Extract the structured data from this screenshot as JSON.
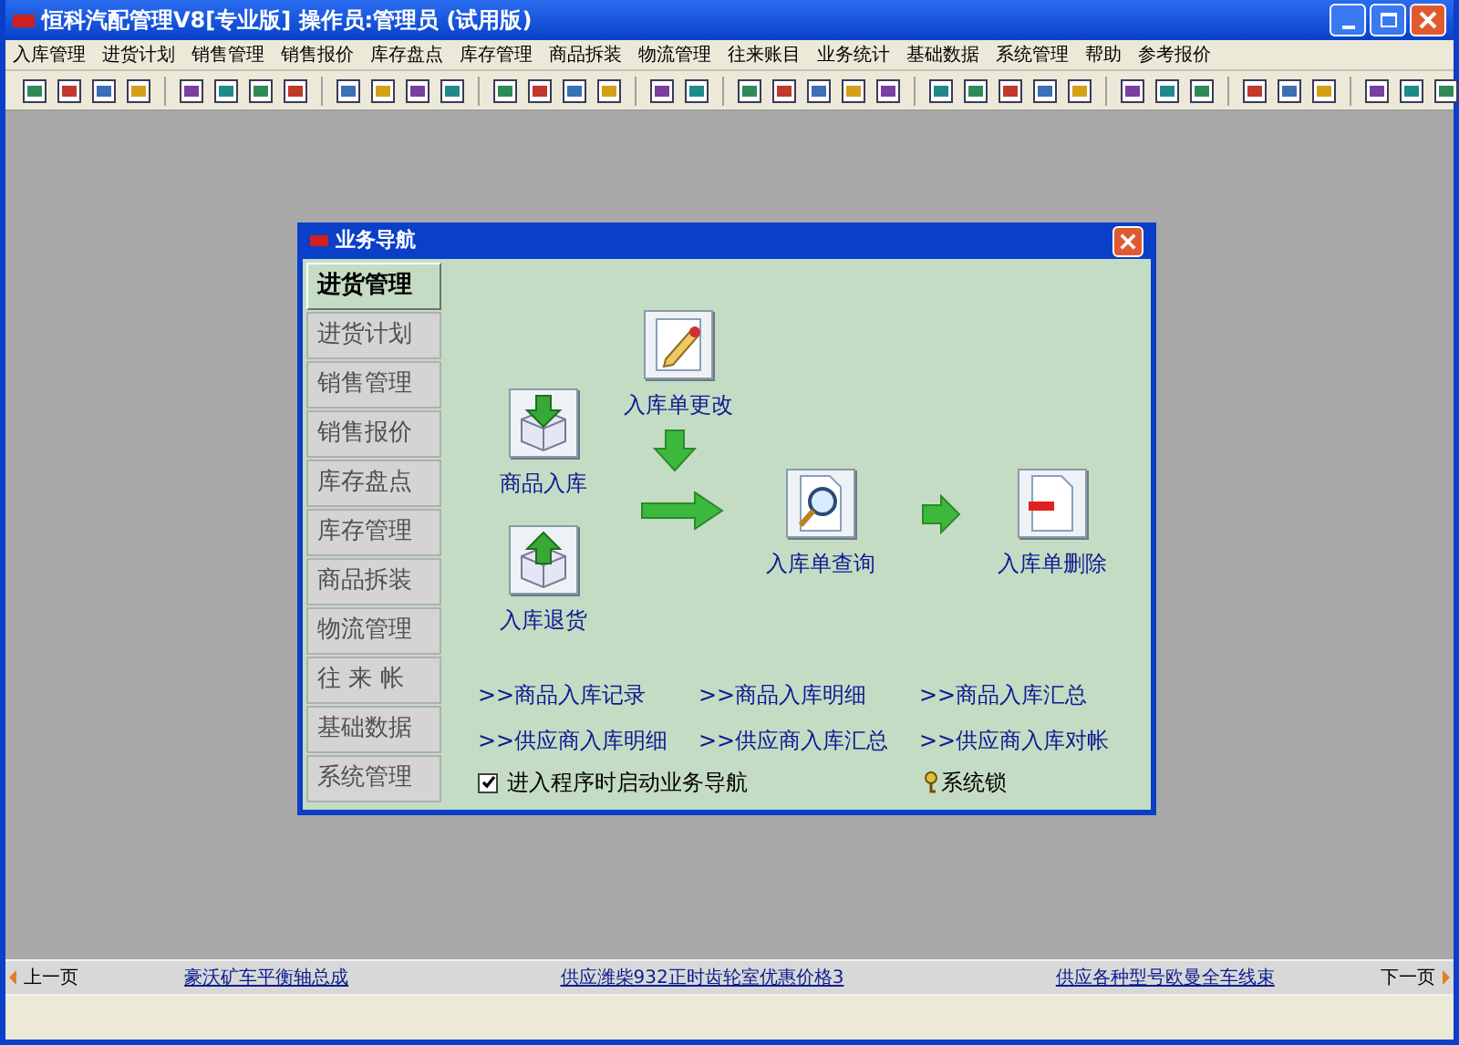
{
  "window": {
    "title": "恒科汽配管理V8[专业版] 操作员:管理员 (试用版)"
  },
  "menu": [
    "入库管理",
    "进货计划",
    "销售管理",
    "销售报价",
    "库存盘点",
    "库存管理",
    "商品拆装",
    "物流管理",
    "往来账目",
    "业务统计",
    "基础数据",
    "系统管理",
    "帮助",
    "参考报价"
  ],
  "dialog": {
    "title": "业务导航",
    "sidebar": [
      {
        "label": "进货管理",
        "selected": true
      },
      {
        "label": "进货计划",
        "selected": false
      },
      {
        "label": "销售管理",
        "selected": false
      },
      {
        "label": "销售报价",
        "selected": false
      },
      {
        "label": "库存盘点",
        "selected": false
      },
      {
        "label": "库存管理",
        "selected": false
      },
      {
        "label": "商品拆装",
        "selected": false
      },
      {
        "label": "物流管理",
        "selected": false
      },
      {
        "label": "往 来 帐",
        "selected": false
      },
      {
        "label": "基础数据",
        "selected": false
      },
      {
        "label": "系统管理",
        "selected": false
      }
    ],
    "flow": [
      {
        "kind": "box-in",
        "label": "商品入库"
      },
      {
        "kind": "box-out",
        "label": "入库退货"
      },
      {
        "kind": "edit",
        "label": "入库单更改"
      },
      {
        "kind": "search",
        "label": "入库单查询"
      },
      {
        "kind": "delete",
        "label": "入库单删除"
      }
    ],
    "links": [
      ">>商品入库记录",
      ">>商品入库明细",
      ">>商品入库汇总",
      ">>供应商入库明细",
      ">>供应商入库汇总",
      ">>供应商入库对帐"
    ],
    "startup_checkbox": {
      "label": "进入程序时启动业务导航",
      "checked": true
    },
    "lock": "系统锁"
  },
  "status_bar": {
    "prev": "上一页",
    "links": [
      "豪沃矿车平衡轴总成",
      "供应潍柴932正时齿轮室优惠价格3",
      "供应各种型号欧曼全车线束"
    ],
    "next": "下一页"
  }
}
